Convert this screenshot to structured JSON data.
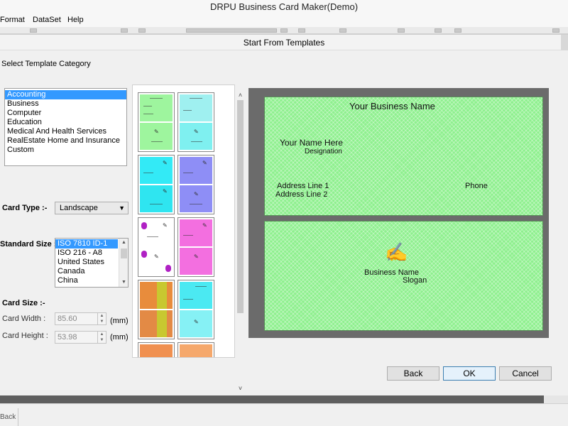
{
  "window": {
    "title": "DRPU Business Card Maker(Demo)"
  },
  "menu": {
    "items": [
      "Format",
      "DataSet",
      "Help"
    ]
  },
  "dialog": {
    "title": "Start From Templates",
    "category_label": "Select Template Category",
    "categories": [
      "Accounting",
      "Business",
      "Computer",
      "Education",
      "Medical And Health Services",
      "RealEstate Home and Insurance",
      "Custom"
    ],
    "selected_category": "Accounting",
    "card_type": {
      "label": "Card Type :-",
      "value": "Landscape"
    },
    "standard_size": {
      "label": "Standard Size :-",
      "options": [
        "ISO 7810 ID-1",
        "ISO 216 - A8",
        "United States",
        "Canada",
        "China"
      ],
      "selected": "ISO 7810 ID-1"
    },
    "card_size": {
      "label": "Card Size :-",
      "width_label": "Card Width :",
      "width_value": "85.60",
      "height_label": "Card Height :",
      "height_value": "53.98",
      "unit": "(mm)"
    },
    "buttons": {
      "back": "Back",
      "ok": "OK",
      "cancel": "Cancel"
    }
  },
  "preview": {
    "front": {
      "business_name": "Your Business Name",
      "your_name": "Your Name Here",
      "designation": "Designation",
      "address1": "Address Line 1",
      "address2": "Address Line 2",
      "phone": "Phone"
    },
    "back": {
      "business_name": "Business Name",
      "slogan": "Slogan"
    },
    "card_color": "#8ef08e",
    "background_color": "#6b6b6b"
  },
  "thumbnails": [
    {
      "top_color": "#9ef59e",
      "bottom_color": "#9ef59e"
    },
    {
      "top_color": "#9ff0f0",
      "bottom_color": "#7ff0f0"
    },
    {
      "top_color": "#33eaf6",
      "bottom_color": "#2fe5f0"
    },
    {
      "top_color": "#8e8ef6",
      "bottom_color": "#8e8ef6"
    },
    {
      "top_color": "#ffffff",
      "bottom_color": "#ffffff"
    },
    {
      "top_color": "#f36fe0",
      "bottom_color": "#f36fe0"
    },
    {
      "top_color": "#e88c3c",
      "bottom_color": "#e38a45"
    },
    {
      "top_color": "#4be9f2",
      "bottom_color": "#86f1f5"
    },
    {
      "top_color": "#f09050",
      "bottom_color": "#f09050"
    },
    {
      "top_color": "#f5a86c",
      "bottom_color": "#f5a86c"
    }
  ],
  "status": {
    "text": "Back"
  }
}
